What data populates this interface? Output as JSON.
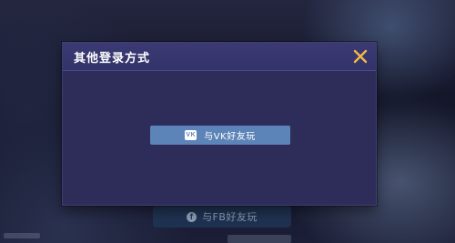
{
  "dialog": {
    "title": "其他登录方式",
    "close_icon": "close-icon",
    "accent_color": "#f0b84a"
  },
  "login_options": [
    {
      "label": "与VK好友玩",
      "icon": "vk-icon",
      "icon_text": "VK",
      "color": "#5d84b8"
    }
  ],
  "background": {
    "fb_button_label": "与FB好友玩",
    "fb_icon_text": "f"
  }
}
